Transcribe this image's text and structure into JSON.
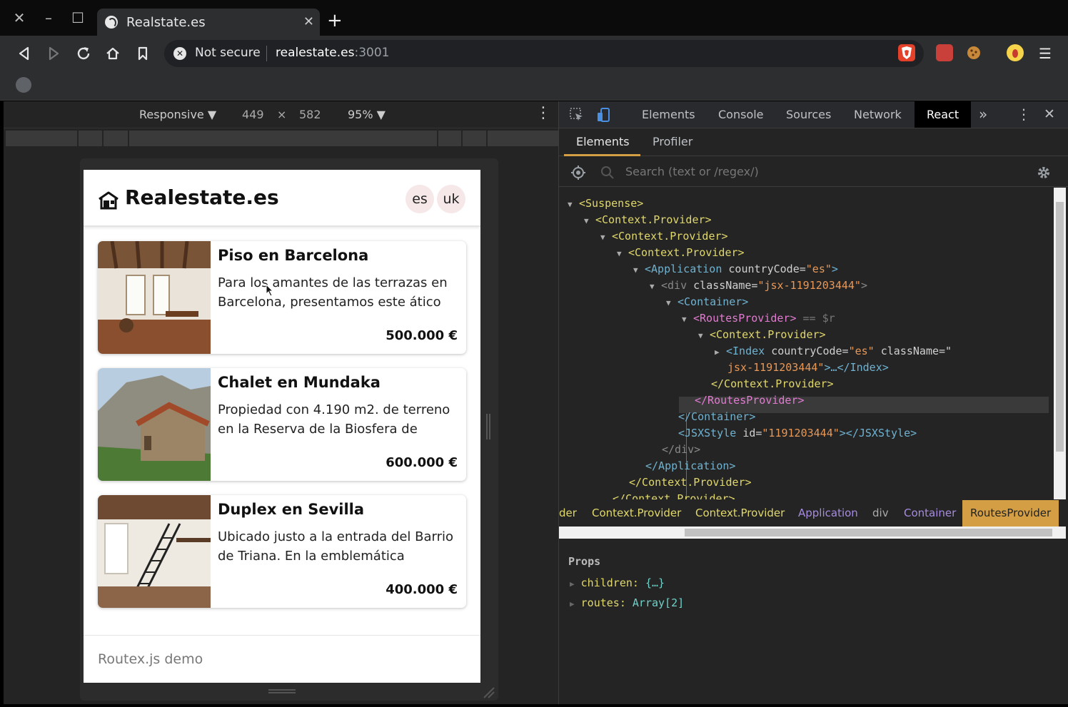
{
  "browser": {
    "tab_title": "Realstate.es",
    "not_secure": "Not secure",
    "url_host": "realestate.es",
    "url_port": ":3001"
  },
  "device_toolbar": {
    "mode": "Responsive ▼",
    "width": "449",
    "times": "×",
    "height": "582",
    "zoom": "95% ▼"
  },
  "site": {
    "brand": "Realestate.es",
    "languages": [
      "es",
      "uk"
    ],
    "listings": [
      {
        "title": "Piso en Barcelona",
        "description": "Para los amantes de las terrazas en Barcelona, presentamos este ático",
        "price": "500.000 €"
      },
      {
        "title": "Chalet en Mundaka",
        "description": "Propiedad con 4.190 m2. de terreno en la Reserva de la Biosfera de",
        "price": "600.000 €"
      },
      {
        "title": "Duplex en Sevilla",
        "description": "Ubicado justo a la entrada del Barrio de Triana. En la emblemática",
        "price": "400.000 €"
      }
    ],
    "footer": "Routex.js demo"
  },
  "devtools": {
    "tabs": [
      "Elements",
      "Console",
      "Sources",
      "Network",
      "React"
    ],
    "active_tab": "React",
    "react_tabs": [
      "Elements",
      "Profiler"
    ],
    "search_placeholder": "Search (text or /regex/)",
    "tree": {
      "suspense": "<Suspense>",
      "ctx": "<Context.Provider>",
      "app_tag": "<Application",
      "attr_countryCode": "countryCode=",
      "val_es": "\"es\"",
      "div_tag": "<div",
      "attr_className": "className=",
      "val_jsx1": "\"jsx-1191203444\"",
      "container": "<Container>",
      "routes": "<RoutesProvider>",
      "routes_suffix": "== $r",
      "index_tag": "<Index",
      "attr_className2": "className=\"",
      "val_jsx2": "jsx-1191203444\"",
      "index_close": ">…</Index>",
      "ctx_close": "</Context.Provider>",
      "routes_close": "</RoutesProvider>",
      "container_close": "</Container>",
      "jsxstyle": "<JSXStyle",
      "attr_id": "id=",
      "val_id": "\"1191203444\"",
      "jsxstyle_close": "></JSXStyle>",
      "div_close": "</div>",
      "app_close": "</Application>"
    },
    "breadcrumbs": [
      "der",
      "Context.Provider",
      "Context.Provider",
      "Application",
      "div",
      "Container",
      "RoutesProvider"
    ],
    "props_title": "Props",
    "props": [
      {
        "key": "children:",
        "value": "{…}"
      },
      {
        "key": "routes:",
        "value": "Array[2]"
      }
    ]
  }
}
